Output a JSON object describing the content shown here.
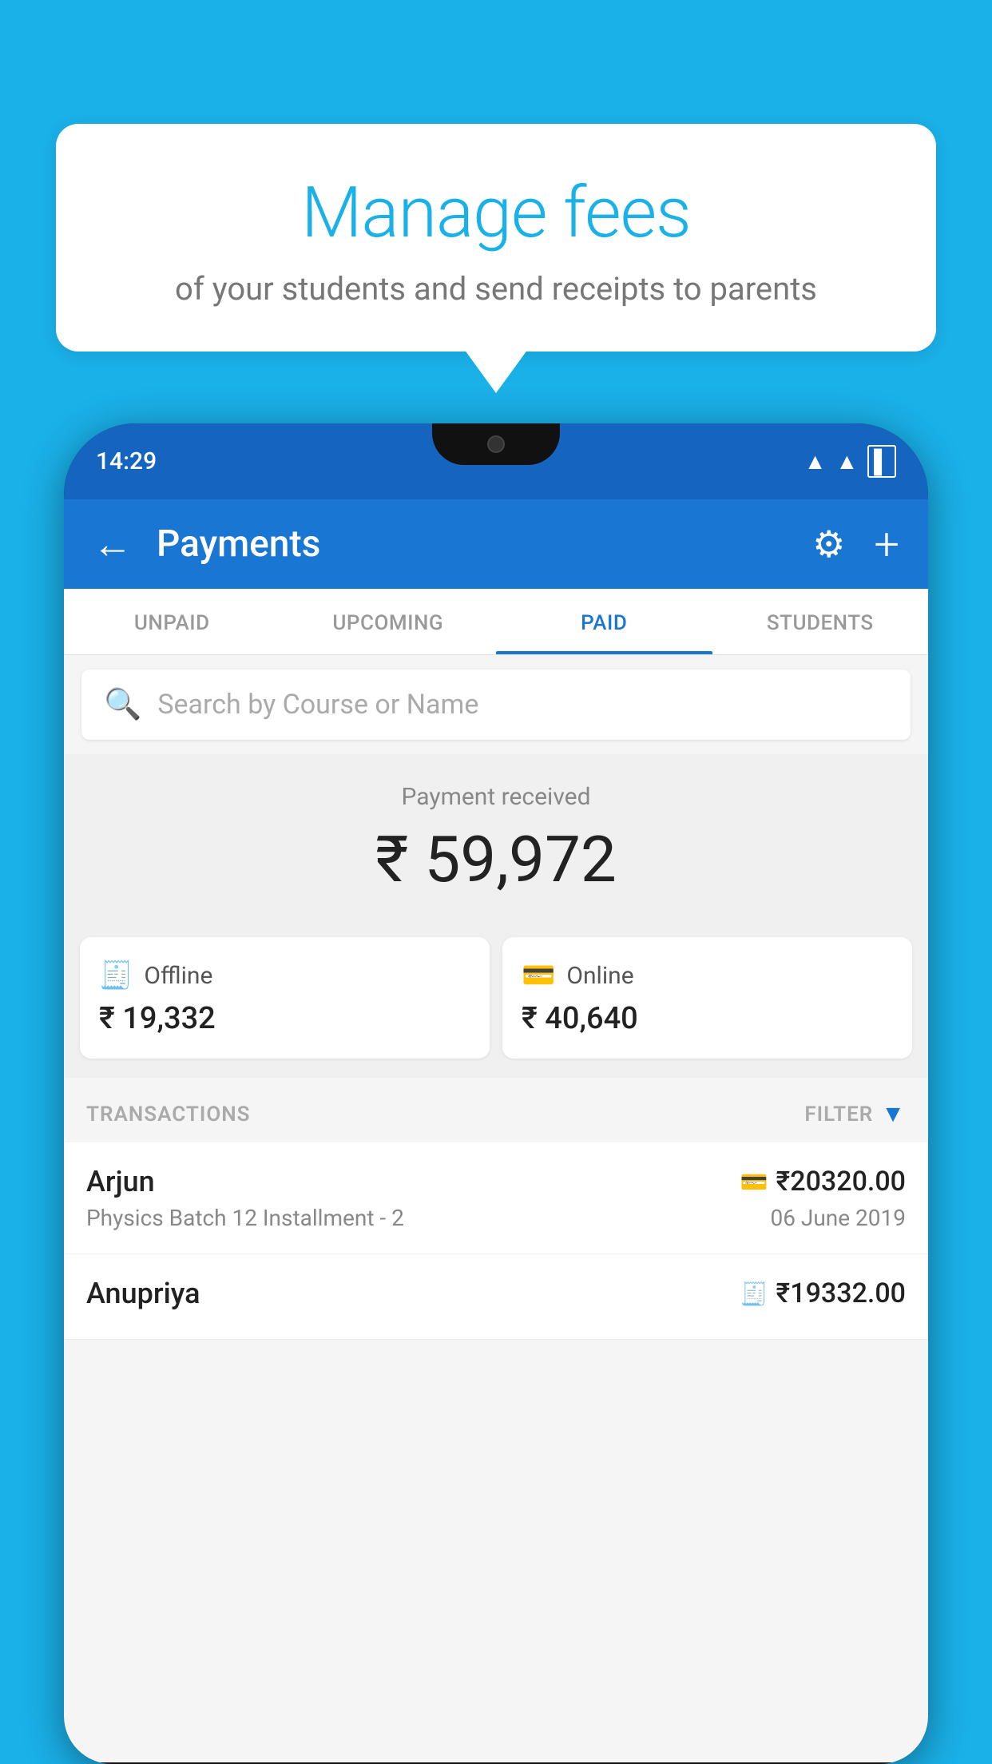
{
  "background_color": "#1ab0e8",
  "speech_bubble": {
    "title": "Manage fees",
    "subtitle": "of your students and send receipts to parents"
  },
  "phone": {
    "status_bar": {
      "time": "14:29"
    },
    "app_bar": {
      "title": "Payments",
      "back_icon": "←",
      "settings_icon": "⚙",
      "add_icon": "+"
    },
    "tabs": [
      {
        "label": "UNPAID",
        "active": false
      },
      {
        "label": "UPCOMING",
        "active": false
      },
      {
        "label": "PAID",
        "active": true
      },
      {
        "label": "STUDENTS",
        "active": false
      }
    ],
    "search": {
      "placeholder": "Search by Course or Name"
    },
    "payment_summary": {
      "label": "Payment received",
      "amount": "₹ 59,972"
    },
    "payment_cards": [
      {
        "type": "Offline",
        "amount": "₹ 19,332",
        "icon": "offline"
      },
      {
        "type": "Online",
        "amount": "₹ 40,640",
        "icon": "online"
      }
    ],
    "transactions_header": {
      "label": "TRANSACTIONS",
      "filter_label": "FILTER"
    },
    "transactions": [
      {
        "name": "Arjun",
        "description": "Physics Batch 12 Installment - 2",
        "amount": "₹20320.00",
        "date": "06 June 2019",
        "payment_type": "online"
      },
      {
        "name": "Anupriya",
        "description": "",
        "amount": "₹19332.00",
        "date": "",
        "payment_type": "offline"
      }
    ]
  }
}
